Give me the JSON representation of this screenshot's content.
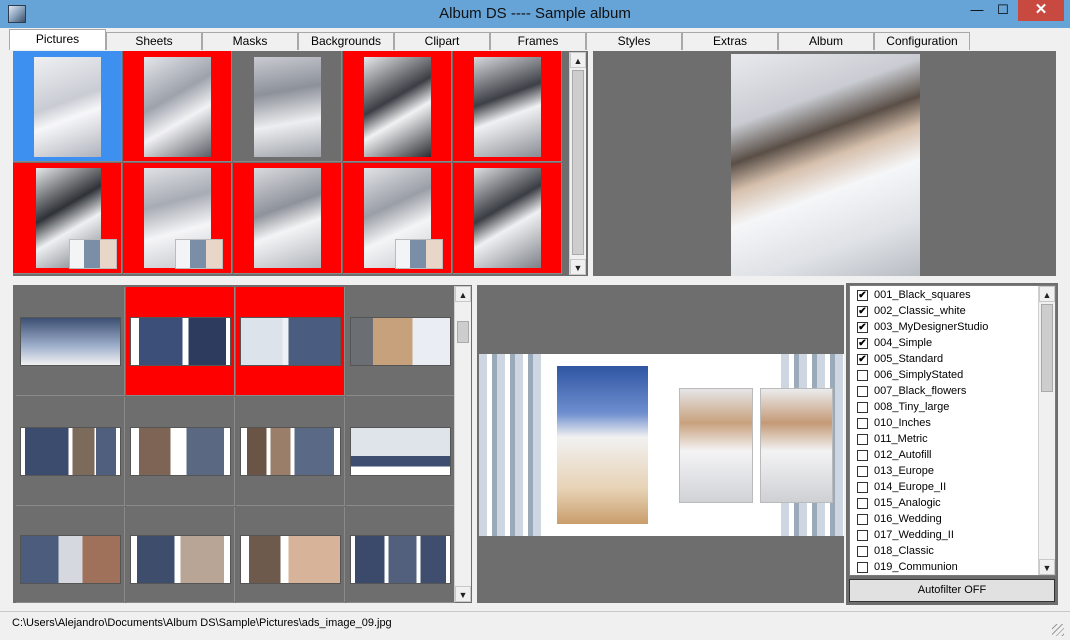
{
  "window": {
    "title": "Album DS  ----  Sample album",
    "minimize_glyph": "—",
    "maximize_glyph": "☐",
    "close_glyph": "✕"
  },
  "tabs": [
    {
      "label": "Pictures",
      "active": true
    },
    {
      "label": "Sheets"
    },
    {
      "label": "Masks"
    },
    {
      "label": "Backgrounds"
    },
    {
      "label": "Clipart"
    },
    {
      "label": "Frames"
    },
    {
      "label": "Styles"
    },
    {
      "label": "Extras"
    },
    {
      "label": "Album"
    },
    {
      "label": "Configuration"
    }
  ],
  "scroll_glyphs": {
    "up": "▲",
    "down": "▼"
  },
  "styles_list": [
    {
      "label": "001_Black_squares",
      "checked": true
    },
    {
      "label": "002_Classic_white",
      "checked": true
    },
    {
      "label": "003_MyDesignerStudio",
      "checked": true
    },
    {
      "label": "004_Simple",
      "checked": true
    },
    {
      "label": "005_Standard",
      "checked": true
    },
    {
      "label": "006_SimplyStated",
      "checked": false
    },
    {
      "label": "007_Black_flowers",
      "checked": false
    },
    {
      "label": "008_Tiny_large",
      "checked": false
    },
    {
      "label": "010_Inches",
      "checked": false
    },
    {
      "label": "011_Metric",
      "checked": false
    },
    {
      "label": "012_Autofill",
      "checked": false
    },
    {
      "label": "013_Europe",
      "checked": false
    },
    {
      "label": "014_Europe_II",
      "checked": false
    },
    {
      "label": "015_Analogic",
      "checked": false
    },
    {
      "label": "016_Wedding",
      "checked": false
    },
    {
      "label": "017_Wedding_II",
      "checked": false
    },
    {
      "label": "018_Classic",
      "checked": false
    },
    {
      "label": "019_Communion",
      "checked": false
    }
  ],
  "check_glyph": "✔",
  "autofilter_label": "Autofilter OFF",
  "status_path": "C:\\Users\\Alejandro\\Documents\\Album DS\\Sample\\Pictures\\ads_image_09.jpg",
  "colors": {
    "titlebar": "#66a4d8",
    "panel": "#6e6e6e",
    "selected_cell": "#ff0000",
    "current_cell": "#3d8ff0"
  }
}
